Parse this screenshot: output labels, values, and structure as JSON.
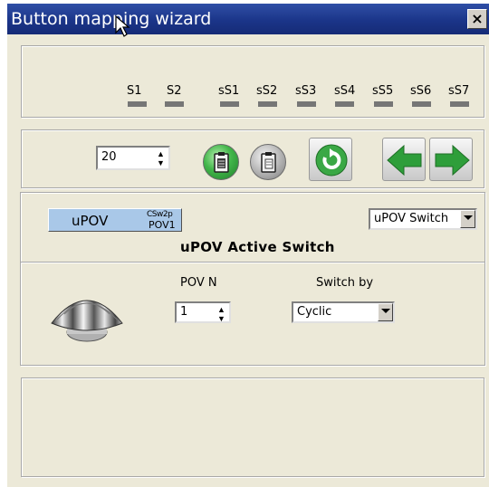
{
  "window": {
    "title": "Button mapping wizard",
    "close_glyph": "×",
    "titlebar_color": "#1b3589",
    "body_color": "#ece9d8"
  },
  "switches": {
    "labels": [
      "S1",
      "S2",
      "sS1",
      "sS2",
      "sS3",
      "sS4",
      "sS5",
      "sS6",
      "sS7"
    ],
    "indicator_color": "#767676"
  },
  "toolbar": {
    "number_value": "20",
    "copy_icon": "clipboard-copy-icon",
    "paste_icon": "clipboard-paste-icon",
    "refresh_icon": "refresh-icon",
    "back_icon": "arrow-left-icon",
    "forward_icon": "arrow-right-icon",
    "accent_green": "#2e9e3a"
  },
  "upov": {
    "button_label": "uPOV",
    "button_sub_top": "CSw2p",
    "button_sub_bottom": "POV1",
    "type_select_value": "uPOV Switch",
    "heading": "uPOV Active Switch",
    "pov_label": "POV N",
    "pov_value": "1",
    "switch_by_label": "Switch by",
    "switch_by_value": "Cyclic",
    "hat_icon": "hat-switch-icon"
  }
}
